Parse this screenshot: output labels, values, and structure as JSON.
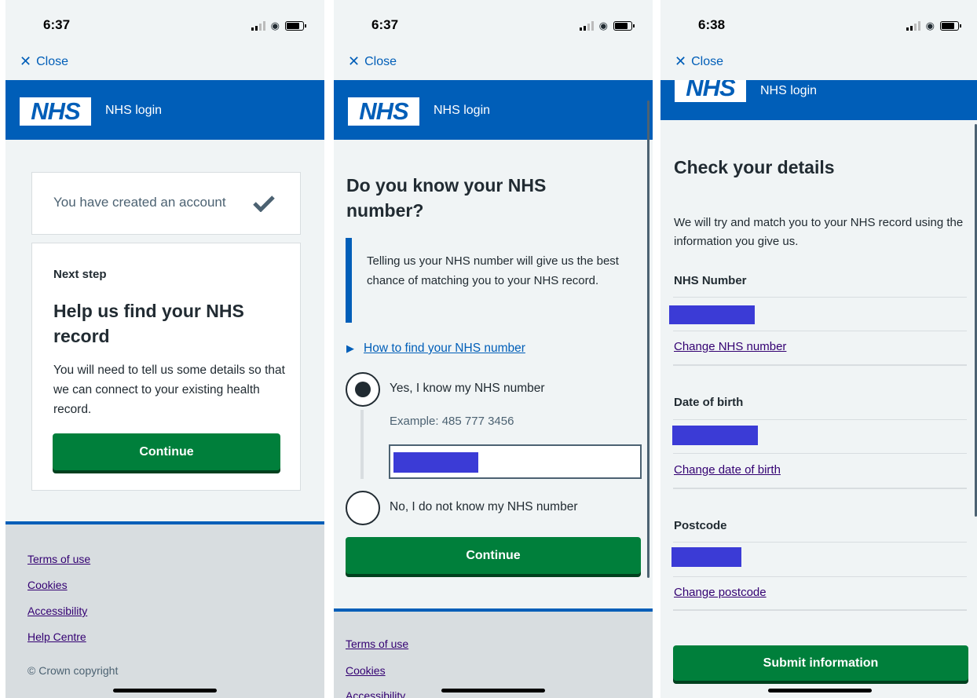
{
  "screens": [
    {
      "status_time": "6:37",
      "close_label": "Close",
      "header_title": "NHS login",
      "logo_text": "NHS",
      "account_created": "You have created an account",
      "next_step_caption": "Next step",
      "heading": "Help us find your NHS record",
      "body": "You will need to tell us some details so that we can connect to your existing health record.",
      "continue_label": "Continue",
      "footer_links": [
        "Terms of use",
        "Cookies",
        "Accessibility",
        "Help Centre"
      ],
      "copyright": "© Crown copyright"
    },
    {
      "status_time": "6:37",
      "close_label": "Close",
      "header_title": "NHS login",
      "logo_text": "NHS",
      "heading": "Do you know your NHS number?",
      "inset_text": "Telling us your NHS number will give us the best chance of matching you to your NHS record.",
      "details_link": "How to find your NHS number",
      "option_yes": "Yes, I know my NHS number",
      "hint": "Example: 485 777 3456",
      "option_no": "No, I do not know my NHS number",
      "continue_label": "Continue",
      "footer_links": [
        "Terms of use",
        "Cookies",
        "Accessibility"
      ]
    },
    {
      "status_time": "6:38",
      "close_label": "Close",
      "header_title": "NHS login",
      "logo_text": "NHS",
      "heading": "Check your details",
      "intro": "We will try and match you to your NHS record using the information you give us.",
      "rows": [
        {
          "label": "NHS Number",
          "change": "Change NHS number"
        },
        {
          "label": "Date of birth",
          "change": "Change date of birth"
        },
        {
          "label": "Postcode",
          "change": "Change postcode"
        }
      ],
      "submit_label": "Submit information"
    }
  ],
  "colors": {
    "nhs_blue": "#005eb8",
    "button_green": "#007f3b",
    "redaction": "#3b3bd6"
  }
}
